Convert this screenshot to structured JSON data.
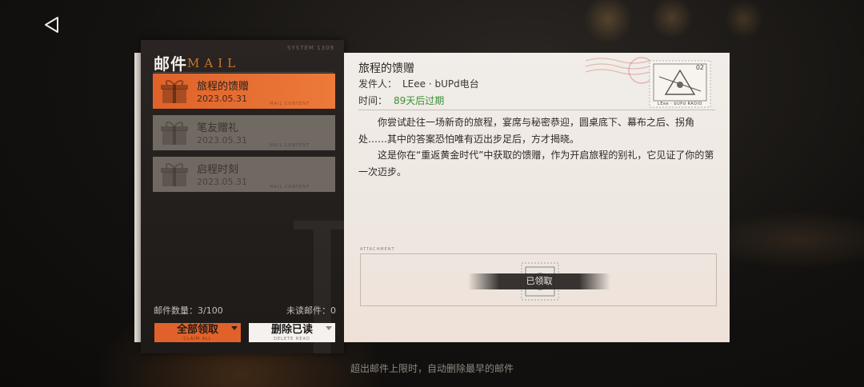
{
  "sidebar": {
    "title": "邮件",
    "title_en": "MAIL",
    "serial": "SYSTEM 1309",
    "items": [
      {
        "title": "旅程的馈赠",
        "date": "2023.05.31",
        "tiny": "MAIL CONTENT",
        "active": true
      },
      {
        "title": "笔友赠礼",
        "date": "2023.05.31",
        "tiny": "MAIL CONTENT",
        "active": false
      },
      {
        "title": "启程时刻",
        "date": "2023.05.31",
        "tiny": "MAIL CONTENT",
        "active": false
      }
    ],
    "count_label": "邮件数量：3/100",
    "unread_label": "未读邮件：0",
    "claim_all": {
      "label": "全部领取",
      "sub": "CLAIM ALL"
    },
    "delete_read": {
      "label": "删除已读",
      "sub": "DELETE READ"
    }
  },
  "mail": {
    "title": "旅程的馈赠",
    "sender_label": "发件人：",
    "sender": "LEee · bUPd电台",
    "time_label": "时间：",
    "time_value": "89天后过期",
    "body": [
      "你尝试赴往一场新奇的旅程，宴席与秘密恭迎，圆桌底下、幕布之后、拐角处……其中的答案恐怕唯有迈出步足后，方才揭晓。",
      "这是你在“重返黄金时代”中获取的馈赠，作为开启旅程的别礼，它见证了你的第一次迈步。"
    ],
    "stamp_text": "LEee · bUPd RADIO",
    "stamp_number": "02",
    "attachment_label": "ATTACHMENT",
    "attachment_claimed": "已领取"
  },
  "footer_note": "超出邮件上限时，自动删除最早的邮件",
  "colors": {
    "accent": "#e0622a",
    "expiry": "#3e8f3a"
  },
  "icons": {
    "back": "back-arrow-icon",
    "gift": "gift-icon"
  }
}
